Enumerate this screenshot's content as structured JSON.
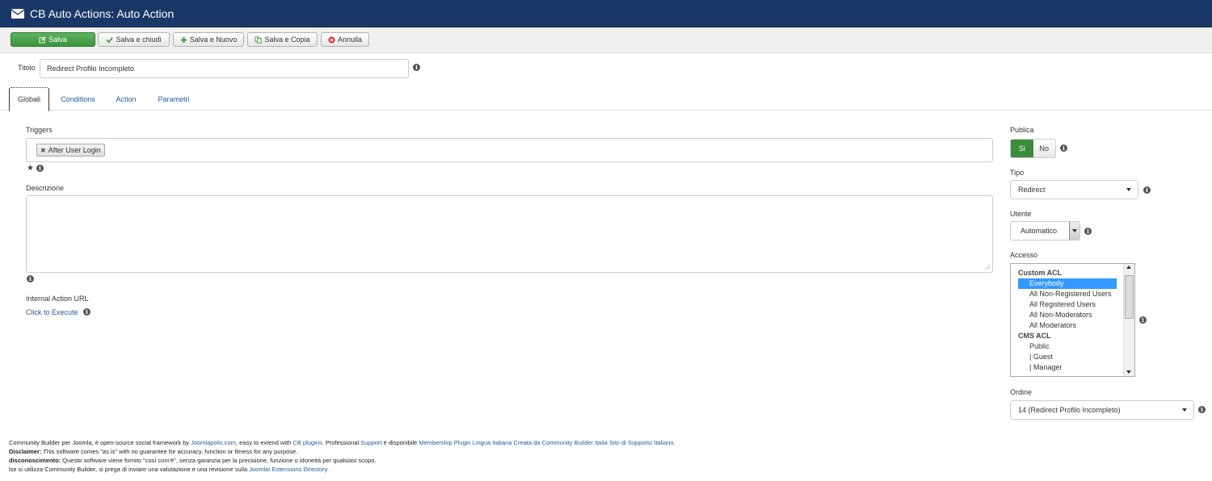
{
  "header": {
    "title": "CB Auto Actions: Auto Action",
    "icon": "envelope-icon",
    "bg": "#1a3867"
  },
  "toolbar": {
    "save": "Salva",
    "save_close": "Salva e chiudi",
    "save_new": "Salva e Nuovo",
    "save_copy": "Salva e Copia",
    "cancel": "Annulla"
  },
  "form": {
    "title_label": "Titolo",
    "title_value": "Redirect Profilo Incompleto"
  },
  "tabs": [
    "Globali",
    "Conditions",
    "Action",
    "Parametri"
  ],
  "main": {
    "triggers_label": "Triggers",
    "trigger_chip": "After User Login",
    "description_label": "Descrizione",
    "internal_url_label": "Internal Action URL",
    "execute_link": "Click to Execute"
  },
  "side": {
    "publish_label": "Publica",
    "publish_yes": "Si",
    "publish_no": "No",
    "type_label": "Tipo",
    "type_value": "Redirect",
    "user_label": "Utente",
    "user_value": "Automatico",
    "access_label": "Accesso",
    "access_groups": [
      {
        "label": "Custom ACL",
        "kind": "group"
      },
      {
        "label": "Everybody",
        "kind": "option",
        "selected": true
      },
      {
        "label": "All Non-Registered Users",
        "kind": "option"
      },
      {
        "label": "All Registered Users",
        "kind": "option"
      },
      {
        "label": "All Non-Moderators",
        "kind": "option"
      },
      {
        "label": "All Moderators",
        "kind": "option"
      },
      {
        "label": "CMS ACL",
        "kind": "group"
      },
      {
        "label": "Public",
        "kind": "option"
      },
      {
        "label": "| Guest",
        "kind": "option"
      },
      {
        "label": "| Manager",
        "kind": "option"
      }
    ],
    "order_label": "Ordine",
    "order_value": "14 (Redirect Profilo Incompleto)"
  },
  "footer": {
    "l1_a": "Community Builder per Joomla, è open-source social framework by ",
    "l1_link1": "Joomlapolis.com",
    "l1_b": ", easy to extend with ",
    "l1_link2": "CB plugins",
    "l1_c": ". Professional ",
    "l1_link3": "Support",
    "l1_d": " è disponibile ",
    "l1_link4": "Membership Plugin Lingua Italiana Creata da Community Builder Italia Sito di Supporto Italiano.",
    "l2_bold": "Disclaimer:",
    "l2_text": " This software comes \"as is\" with no guarantee for accuracy, function or fitness for any purpose.",
    "l3_bold": "disconoscimento:",
    "l3_text": " Questo software viene fornito \"così com'è\", senza garanzia per la precisione, funzione o idoneità per qualsiasi scopo.",
    "l4_text": "lse si utilizza Community Builder, si prega di inviare una valutazione e una revisione sulla ",
    "l4_link": "Joomla! Extensions Directory",
    "l4_end": "."
  }
}
